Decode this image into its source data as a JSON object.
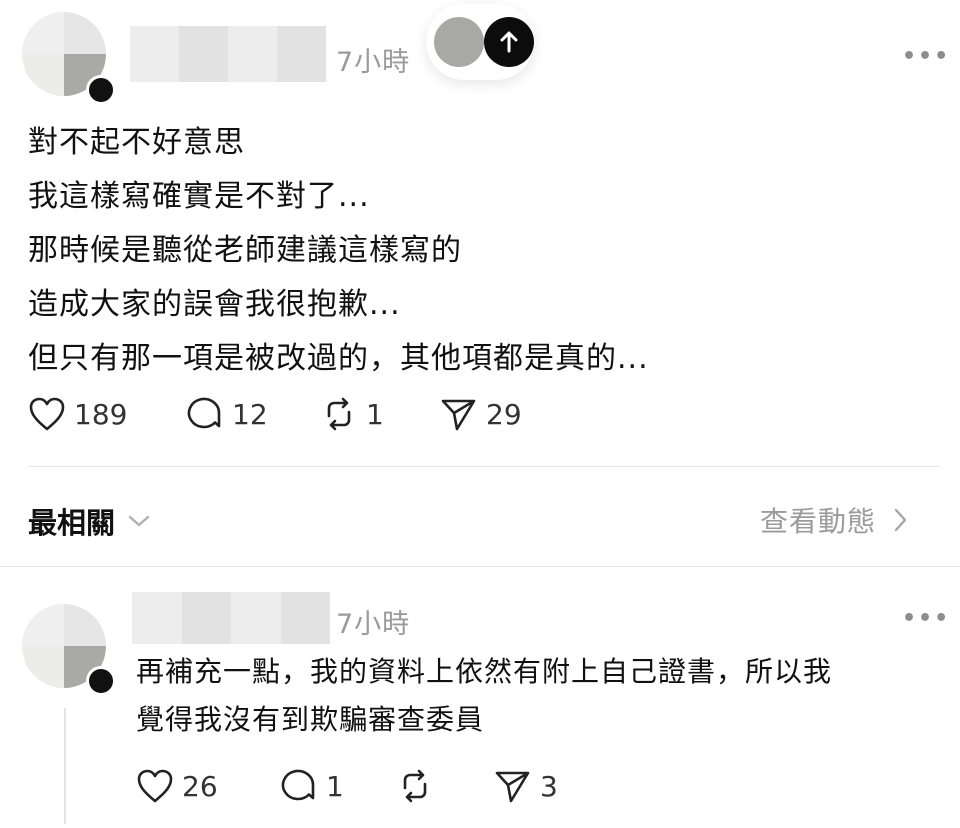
{
  "post": {
    "time": "7小時",
    "more_label": "•••",
    "lines": [
      "對不起不好意思",
      "我這樣寫確實是不對了...",
      "那時候是聽從老師建議這樣寫的",
      "造成大家的誤會我很抱歉...",
      "但只有那一項是被改過的，其他項都是真的..."
    ],
    "likes": "189",
    "comments": "12",
    "reposts": "1",
    "shares": "29"
  },
  "replies_header": {
    "sort_label": "最相關",
    "view_activity_label": "查看動態"
  },
  "reply": {
    "time": "7小時",
    "more_label": "•••",
    "lines": [
      "再補充一點，我的資料上依然有附上自己證書，所以我",
      "覺得我沒有到欺騙審查委員"
    ],
    "likes": "26",
    "comments": "1",
    "reposts": "",
    "shares": "3"
  },
  "icons": {
    "like": "heart-icon",
    "comment": "comment-icon",
    "repost": "repost-icon",
    "share": "send-icon",
    "scroll_up": "arrow-up-icon",
    "chevron_down": "chevron-down-icon",
    "chevron_right": "chevron-right-icon"
  }
}
